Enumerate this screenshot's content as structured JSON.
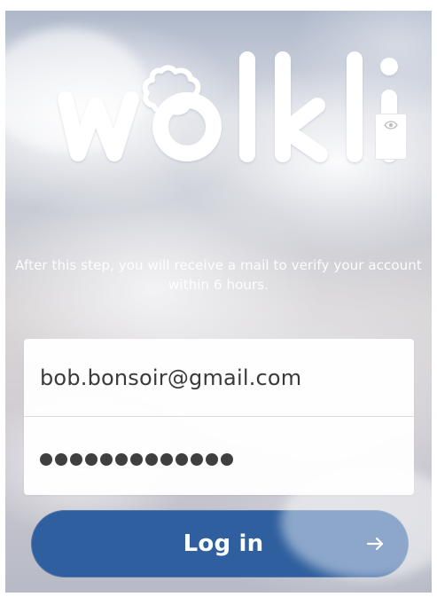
{
  "brand": {
    "logo_text": "wölkli"
  },
  "helper": {
    "message": "After this step, you will receive a mail to verify your account within 6 hours."
  },
  "form": {
    "email_value": "bob.bonsoir@gmail.com",
    "password_mask": "•••••••••••••",
    "password_length": 13,
    "reveal_icon": "eye-icon"
  },
  "login": {
    "label": "Log in",
    "icon": "arrow-right-icon"
  },
  "colors": {
    "accent": "#2f5f9e"
  }
}
